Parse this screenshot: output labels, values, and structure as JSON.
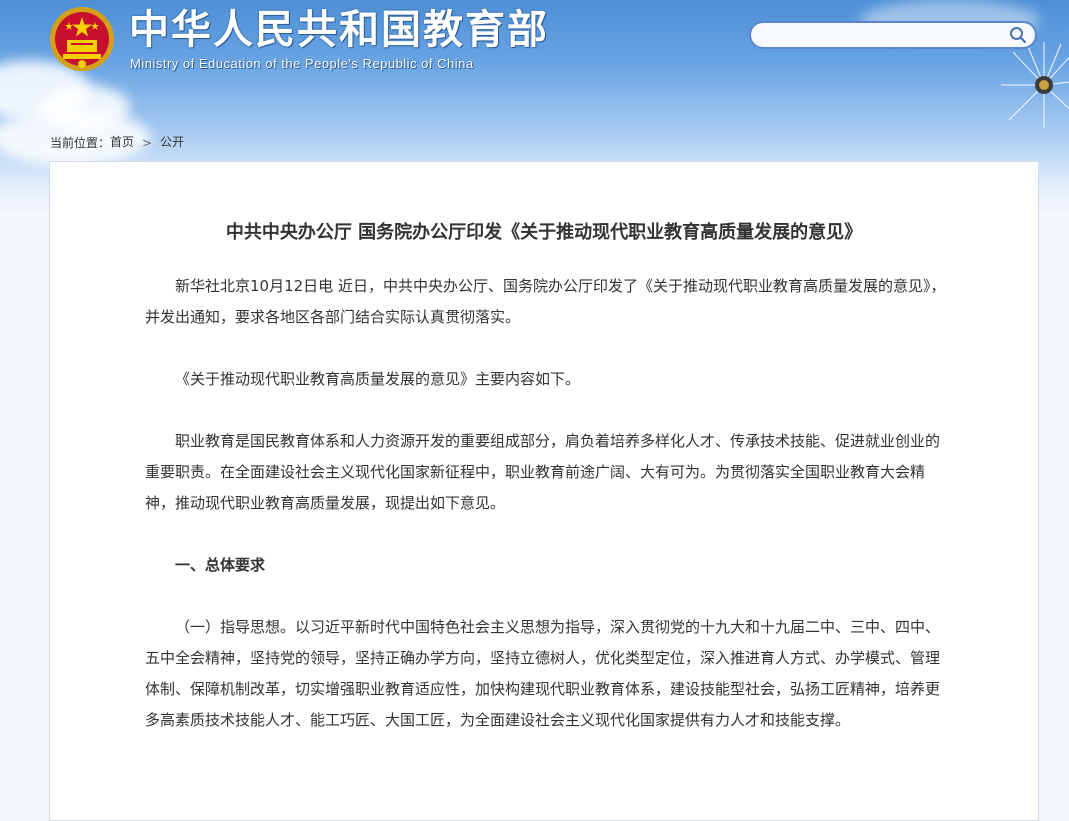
{
  "header": {
    "title_cn": "中华人民共和国教育部",
    "title_en": "Ministry of Education of the People's Republic of China",
    "emblem_icon": "national-emblem-icon"
  },
  "search": {
    "value": "",
    "placeholder": "",
    "icon": "search-icon"
  },
  "breadcrumb": {
    "prefix": "当前位置：",
    "home": "首页",
    "separator": ">",
    "current": "公开"
  },
  "article": {
    "title": "中共中央办公厅 国务院办公厅印发《关于推动现代职业教育高质量发展的意见》",
    "paragraphs": [
      "新华社北京10月12日电 近日，中共中央办公厅、国务院办公厅印发了《关于推动现代职业教育高质量发展的意见》，并发出通知，要求各地区各部门结合实际认真贯彻落实。",
      "《关于推动现代职业教育高质量发展的意见》主要内容如下。",
      "职业教育是国民教育体系和人力资源开发的重要组成部分，肩负着培养多样化人才、传承技术技能、促进就业创业的重要职责。在全面建设社会主义现代化国家新征程中，职业教育前途广阔、大有可为。为贯彻落实全国职业教育大会精神，推动现代职业教育高质量发展，现提出如下意见。",
      "一、总体要求",
      "（一）指导思想。以习近平新时代中国特色社会主义思想为指导，深入贯彻党的十九大和十九届二中、三中、四中、五中全会精神，坚持党的领导，坚持正确办学方向，坚持立德树人，优化类型定位，深入推进育人方式、办学模式、管理体制、保障机制改革，切实增强职业教育适应性，加快构建现代职业教育体系，建设技能型社会，弘扬工匠精神，培养更多高素质技术技能人才、能工巧匠、大国工匠，为全面建设社会主义现代化国家提供有力人才和技能支撑。"
    ]
  },
  "colors": {
    "header_blue": "#4e8fd6",
    "search_border": "#5b86c7",
    "text": "#333333"
  }
}
